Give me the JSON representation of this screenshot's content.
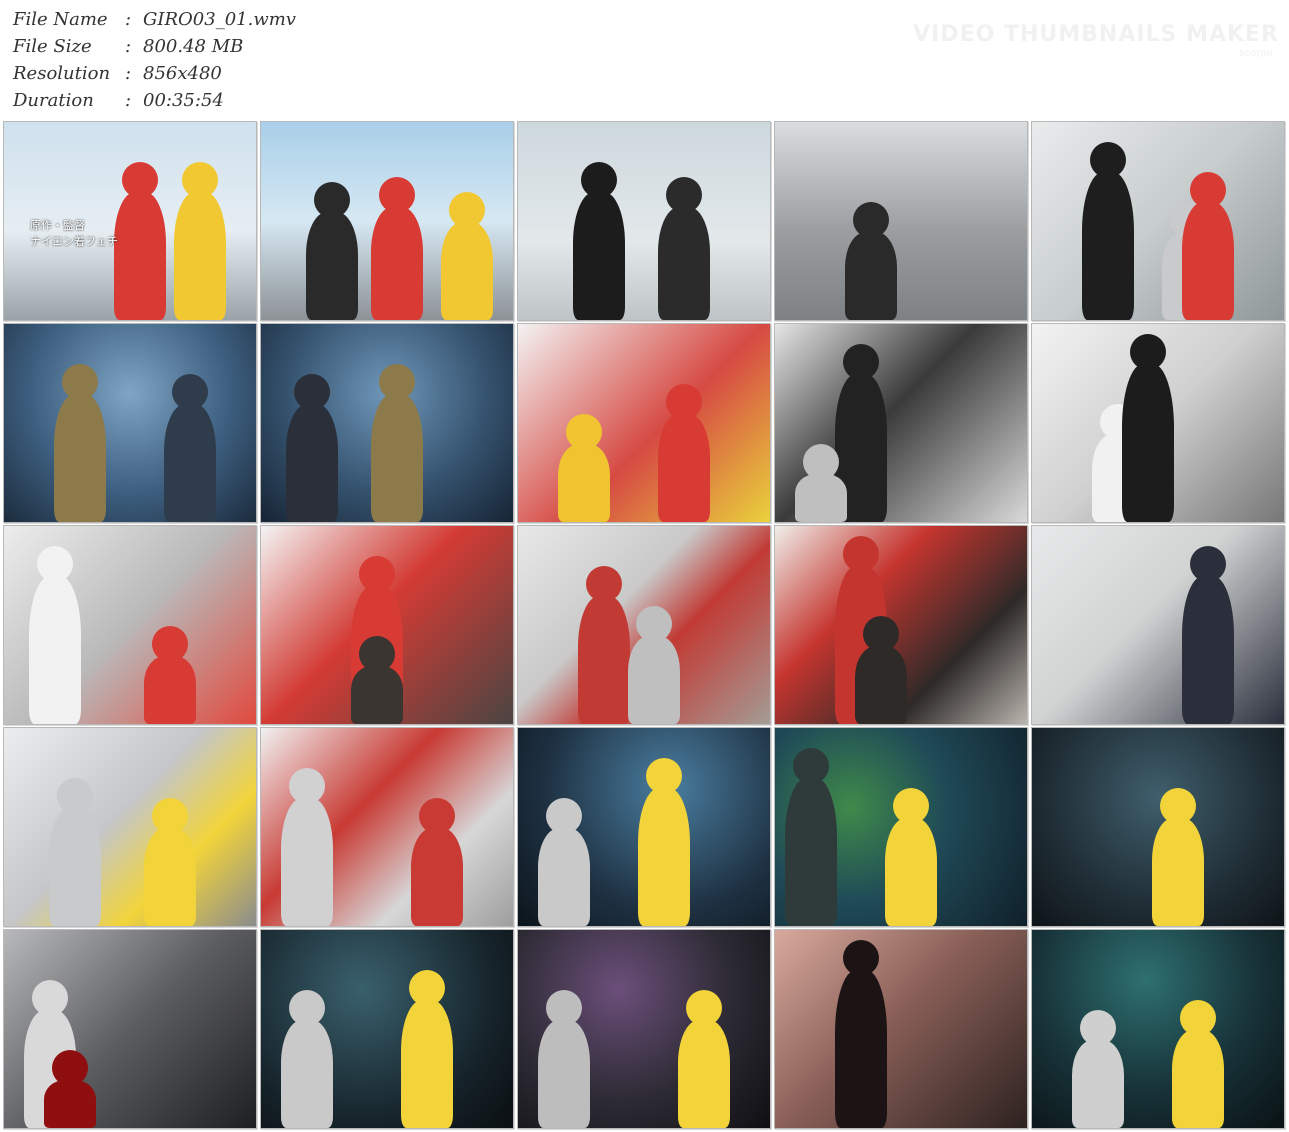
{
  "file_info": {
    "rows": [
      {
        "label": "File Name",
        "sep": ":",
        "value": "GIRO03_01.wmv"
      },
      {
        "label": "File Size",
        "sep": ":",
        "value": "800.48 MB"
      },
      {
        "label": "Resolution",
        "sep": ":",
        "value": "856x480"
      },
      {
        "label": "Duration",
        "sep": ":",
        "value": "00:35:54"
      }
    ]
  },
  "watermark": {
    "title": "VIDEO THUMBNAILS MAKER",
    "subtitle": "scorpn"
  },
  "thumbnail_grid": {
    "columns": 5,
    "rows": 5,
    "first_thumb_caption": [
      "原作・監督",
      "ナイロン着フェチ"
    ]
  },
  "colors": {
    "info_text": "#333333",
    "thumb_border": "#b8b8b8",
    "watermark": "#f1f1f1"
  }
}
